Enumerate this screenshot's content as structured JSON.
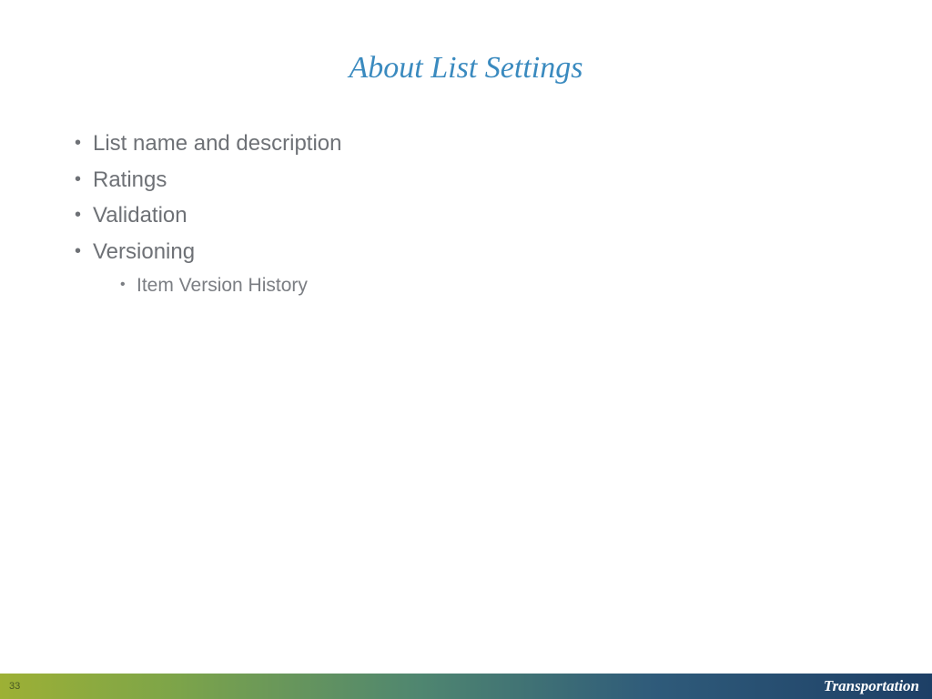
{
  "title": "About List Settings",
  "bullets": {
    "b1": "List name and description",
    "b2": "Ratings",
    "b3": "Validation",
    "b4": "Versioning",
    "b4_sub1": "Item Version History"
  },
  "footer": {
    "page": "33",
    "label": "Transportation"
  }
}
